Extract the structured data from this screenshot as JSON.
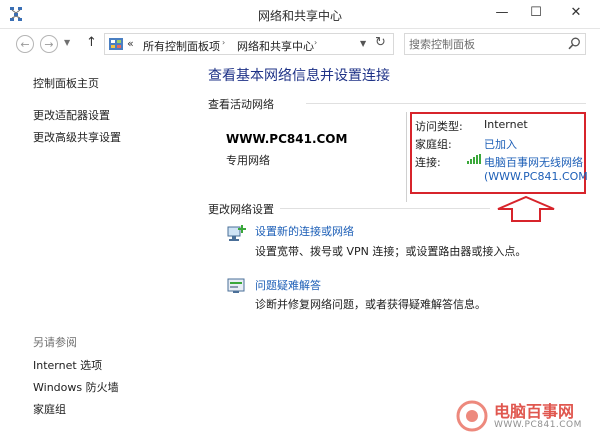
{
  "window": {
    "title": "网络和共享中心",
    "min_glyph": "—",
    "max_glyph": "☐",
    "close_glyph": "✕"
  },
  "address": {
    "crumb_prefix": "«",
    "crumb1": "所有控制面板项",
    "crumb_arrow": "›",
    "crumb2": "网络和共享中心",
    "search_placeholder": "搜索控制面板"
  },
  "leftnav": {
    "items": [
      "控制面板主页",
      "更改适配器设置",
      "更改高级共享设置"
    ],
    "see_also_title": "另请参阅",
    "see_also": [
      "Internet 选项",
      "Windows 防火墙",
      "家庭组"
    ]
  },
  "main": {
    "title": "查看基本网络信息并设置连接",
    "active_networks_heading": "查看活动网络",
    "network_name": "WWW.PC841.COM",
    "network_type": "专用网络",
    "access_type_label": "访问类型:",
    "access_type_value": "Internet",
    "homegroup_label": "家庭组:",
    "homegroup_value": "已加入",
    "connection_label": "连接:",
    "connection_value_line1": "电脑百事网无线网络",
    "connection_value_line2": "(WWW.PC841.COM",
    "change_settings_heading": "更改网络设置",
    "tasks": [
      {
        "link": "设置新的连接或网络",
        "desc": "设置宽带、拨号或 VPN 连接；或设置路由器或接入点。"
      },
      {
        "link": "问题疑难解答",
        "desc": "诊断并修复网络问题，或者获得疑难解答信息。"
      }
    ]
  },
  "watermark": {
    "text": "电脑百事网",
    "url": "WWW.PC841.COM"
  },
  "colors": {
    "title_blue": "#1e3287",
    "link_blue": "#1d5fb7",
    "annotation_red": "#d7242b"
  }
}
